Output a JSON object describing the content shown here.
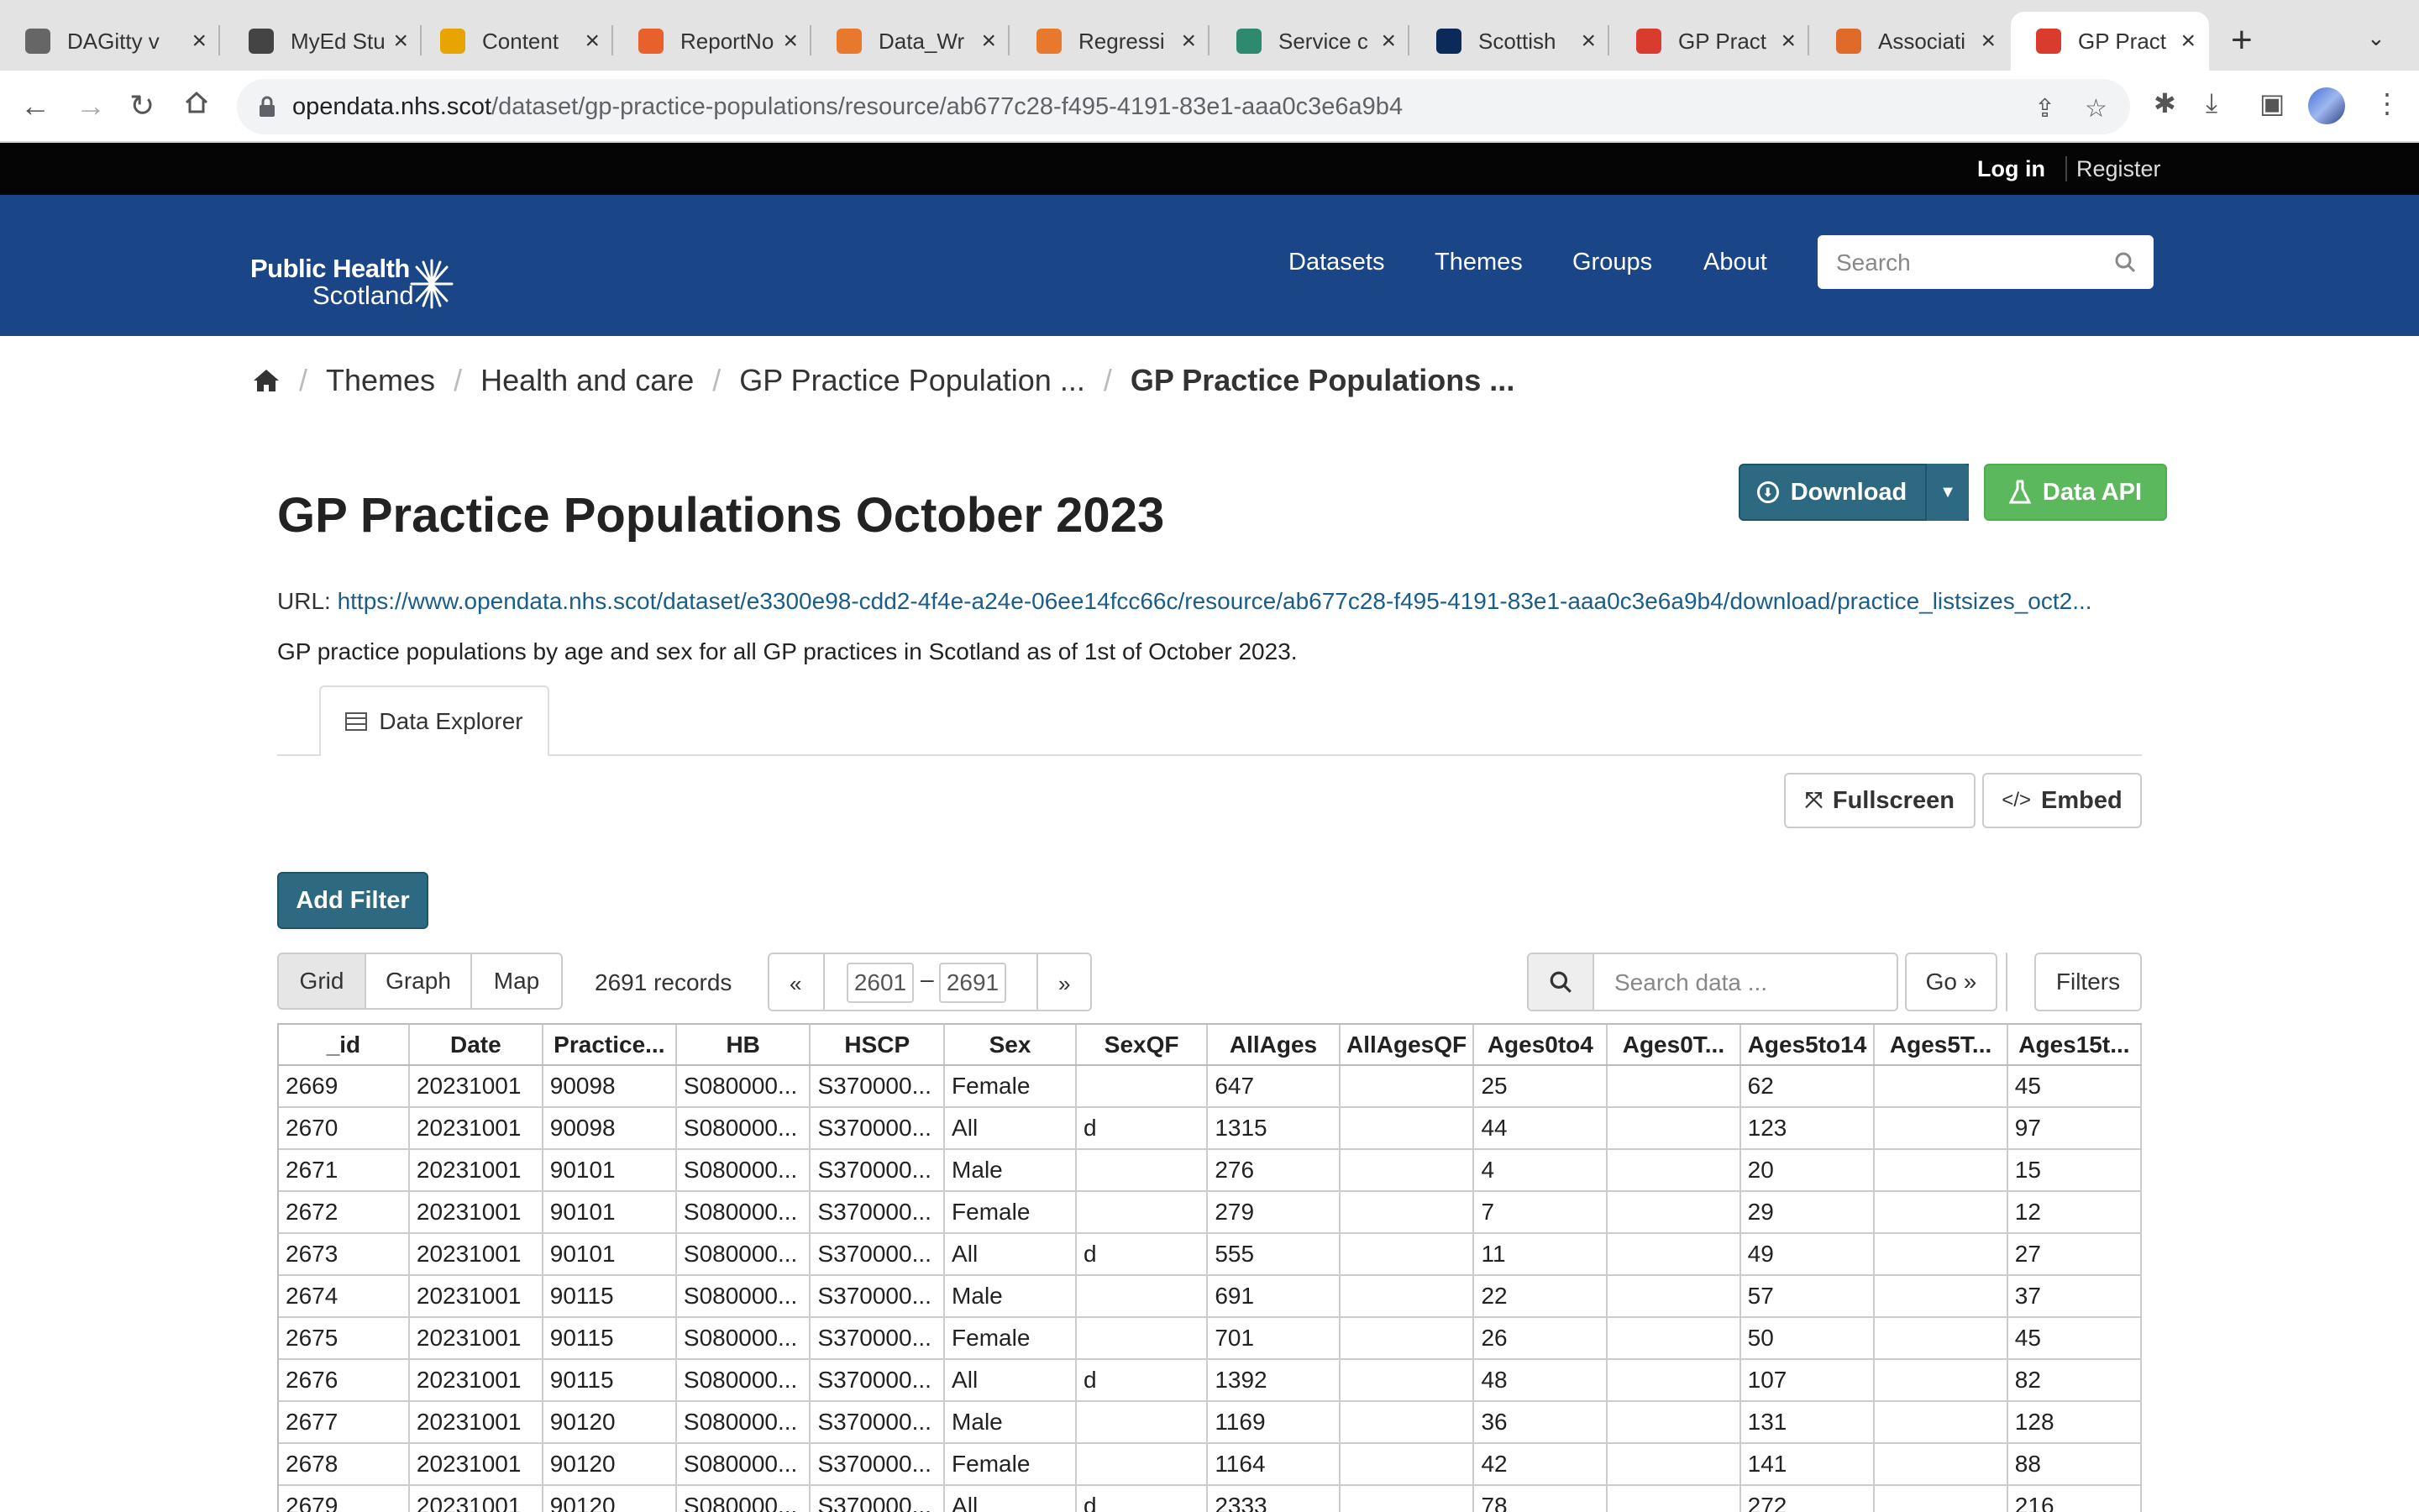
{
  "browser": {
    "tabs": [
      {
        "label": "DAGitty v",
        "favicon_color": "#666666"
      },
      {
        "label": "MyEd Stu",
        "favicon_color": "#444444"
      },
      {
        "label": "Content",
        "favicon_color": "#e8a400"
      },
      {
        "label": "ReportNo",
        "favicon_color": "#e8602c"
      },
      {
        "label": "Data_Wr",
        "favicon_color": "#e8792c"
      },
      {
        "label": "Regressi",
        "favicon_color": "#e8792c"
      },
      {
        "label": "Service c",
        "favicon_color": "#2d8a6e"
      },
      {
        "label": "Scottish",
        "favicon_color": "#0b2a5a"
      },
      {
        "label": "GP Pract",
        "favicon_color": "#d93b2f"
      },
      {
        "label": "Associati",
        "favicon_color": "#e06a2a"
      },
      {
        "label": "GP Pract",
        "favicon_color": "#d93b2f"
      }
    ],
    "active_tab": 10,
    "url_host": "opendata.nhs.scot",
    "url_path": "/dataset/gp-practice-populations/resource/ab677c28-f495-4191-83e1-aaa0c3e6a9b4",
    "icons": [
      "back-icon",
      "forward-icon",
      "reload-icon",
      "home-icon",
      "lock-icon",
      "share-icon",
      "bookmark-star-icon",
      "extensions-icon",
      "download-icon",
      "side-panel-icon",
      "profile-avatar",
      "menu-kebab-icon"
    ]
  },
  "site": {
    "login": "Log in",
    "register": "Register",
    "logo_line1": "Public Health",
    "logo_line2": "Scotland",
    "nav": [
      "Datasets",
      "Themes",
      "Groups",
      "About"
    ],
    "search_placeholder": "Search",
    "brand_color": "#1a4688"
  },
  "breadcrumb": [
    "Themes",
    "Health and care",
    "GP Practice Population ...",
    "GP Practice Populations ..."
  ],
  "resource": {
    "title": "GP Practice Populations October 2023",
    "url_label": "URL:",
    "url": "https://www.opendata.nhs.scot/dataset/e3300e98-cdd2-4f4e-a24e-06ee14fcc66c/resource/ab677c28-f495-4191-83e1-aaa0c3e6a9b4/download/practice_listsizes_oct2...",
    "description": "GP practice populations by age and sex for all GP practices in Scotland as of 1st of October 2023.",
    "download_label": "Download",
    "data_api_label": "Data API"
  },
  "explorer": {
    "tab_label": "Data Explorer",
    "fullscreen_label": "Fullscreen",
    "embed_label": "Embed",
    "add_filter_label": "Add Filter",
    "views": [
      "Grid",
      "Graph",
      "Map"
    ],
    "active_view": "Grid",
    "records": "2691 records",
    "page_from": "2601",
    "page_to": "2691",
    "prev": "«",
    "next": "»",
    "dash": "–",
    "search_placeholder": "Search data ...",
    "go_label": "Go »",
    "filters_label": "Filters"
  },
  "table": {
    "columns": [
      "_id",
      "Date",
      "Practice...",
      "HB",
      "HSCP",
      "Sex",
      "SexQF",
      "AllAges",
      "AllAgesQF",
      "Ages0to4",
      "Ages0T...",
      "Ages5to14",
      "Ages5T...",
      "Ages15t..."
    ],
    "rows": [
      [
        "2669",
        "20231001",
        "90098",
        "S080000...",
        "S370000...",
        "Female",
        "",
        "647",
        "",
        "25",
        "",
        "62",
        "",
        "45"
      ],
      [
        "2670",
        "20231001",
        "90098",
        "S080000...",
        "S370000...",
        "All",
        "d",
        "1315",
        "",
        "44",
        "",
        "123",
        "",
        "97"
      ],
      [
        "2671",
        "20231001",
        "90101",
        "S080000...",
        "S370000...",
        "Male",
        "",
        "276",
        "",
        "4",
        "",
        "20",
        "",
        "15"
      ],
      [
        "2672",
        "20231001",
        "90101",
        "S080000...",
        "S370000...",
        "Female",
        "",
        "279",
        "",
        "7",
        "",
        "29",
        "",
        "12"
      ],
      [
        "2673",
        "20231001",
        "90101",
        "S080000...",
        "S370000...",
        "All",
        "d",
        "555",
        "",
        "11",
        "",
        "49",
        "",
        "27"
      ],
      [
        "2674",
        "20231001",
        "90115",
        "S080000...",
        "S370000...",
        "Male",
        "",
        "691",
        "",
        "22",
        "",
        "57",
        "",
        "37"
      ],
      [
        "2675",
        "20231001",
        "90115",
        "S080000...",
        "S370000...",
        "Female",
        "",
        "701",
        "",
        "26",
        "",
        "50",
        "",
        "45"
      ],
      [
        "2676",
        "20231001",
        "90115",
        "S080000...",
        "S370000...",
        "All",
        "d",
        "1392",
        "",
        "48",
        "",
        "107",
        "",
        "82"
      ],
      [
        "2677",
        "20231001",
        "90120",
        "S080000...",
        "S370000...",
        "Male",
        "",
        "1169",
        "",
        "36",
        "",
        "131",
        "",
        "128"
      ],
      [
        "2678",
        "20231001",
        "90120",
        "S080000...",
        "S370000...",
        "Female",
        "",
        "1164",
        "",
        "42",
        "",
        "141",
        "",
        "88"
      ],
      [
        "2679",
        "20231001",
        "90120",
        "S080000...",
        "S370000...",
        "All",
        "d",
        "2333",
        "",
        "78",
        "",
        "272",
        "",
        "216"
      ]
    ]
  }
}
